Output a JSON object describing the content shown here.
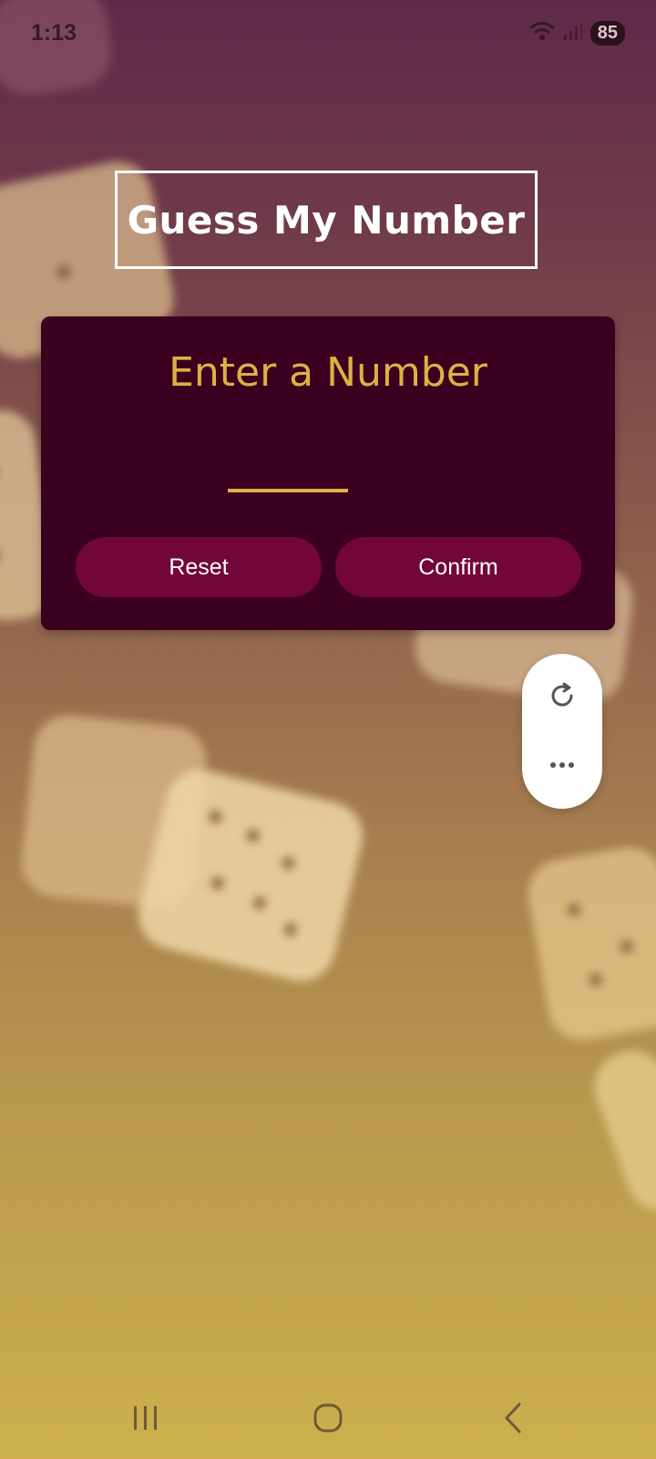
{
  "status_bar": {
    "time": "1:13",
    "battery": "85",
    "icons": [
      "wifi-icon",
      "signal-icon"
    ]
  },
  "title": "Guess My Number",
  "card": {
    "heading": "Enter a Number",
    "input_value": "",
    "reset_label": "Reset",
    "confirm_label": "Confirm"
  },
  "floating_controls": {
    "icons": [
      "refresh-icon",
      "more-icon"
    ]
  },
  "nav_bar": {
    "icons": [
      "recents-icon",
      "home-icon",
      "back-icon"
    ]
  },
  "colors": {
    "card_background": "#3b0020",
    "accent_gold": "#ddb143",
    "button_background": "#72063b",
    "title_color": "#ffffff"
  }
}
